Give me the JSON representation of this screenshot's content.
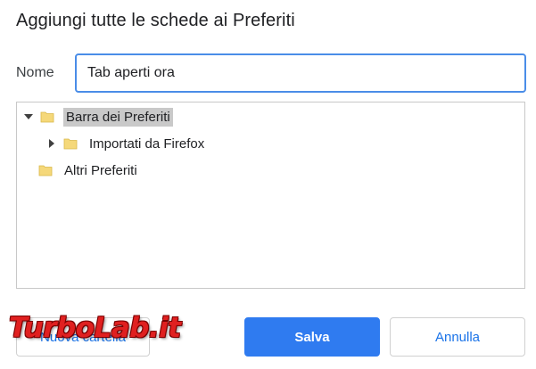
{
  "dialog": {
    "title": "Aggiungi tutte le schede ai Preferiti"
  },
  "name_field": {
    "label": "Nome",
    "value": "Tab aperti ora"
  },
  "tree": {
    "items": [
      {
        "label": "Barra dei Preferiti",
        "expanded": true,
        "selected": true,
        "icon": "folder-icon"
      },
      {
        "label": "Importati da Firefox",
        "expanded": false,
        "selected": false,
        "icon": "folder-icon"
      },
      {
        "label": "Altri Preferiti",
        "expanded": false,
        "selected": false,
        "icon": "folder-icon"
      }
    ]
  },
  "buttons": {
    "new_folder": "Nuova cartella",
    "save": "Salva",
    "cancel": "Annulla"
  },
  "watermark": {
    "text": "TurboLab.it"
  },
  "colors": {
    "accent": "#2f7bf0",
    "focus_border": "#4a8de8",
    "selection": "#c9c9c9",
    "folder": "#f5d87a",
    "watermark": "#e02020"
  }
}
